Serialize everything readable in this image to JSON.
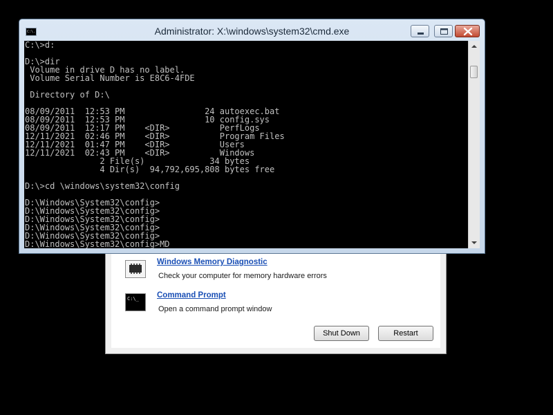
{
  "cmd_window": {
    "title": "Administrator: X:\\windows\\system32\\cmd.exe",
    "icon_label": "C:\\.",
    "console_lines": [
      "C:\\>d:",
      "",
      "D:\\>dir",
      " Volume in drive D has no label.",
      " Volume Serial Number is E8C6-4FDE",
      "",
      " Directory of D:\\",
      "",
      "08/09/2011  12:53 PM                24 autoexec.bat",
      "08/09/2011  12:53 PM                10 config.sys",
      "08/09/2011  12:17 PM    <DIR>          PerfLogs",
      "12/11/2021  02:46 PM    <DIR>          Program Files",
      "12/11/2021  01:47 PM    <DIR>          Users",
      "12/11/2021  02:43 PM    <DIR>          Windows",
      "               2 File(s)             34 bytes",
      "               4 Dir(s)  94,792,695,808 bytes free",
      "",
      "D:\\>cd \\windows\\system32\\config",
      "",
      "D:\\Windows\\System32\\config>",
      "D:\\Windows\\System32\\config>",
      "D:\\Windows\\System32\\config>",
      "D:\\Windows\\System32\\config>",
      "D:\\Windows\\System32\\config>",
      "D:\\Windows\\System32\\config>MD"
    ]
  },
  "recovery": {
    "options": [
      {
        "title": "Windows Memory Diagnostic",
        "description": "Check your computer for memory hardware errors",
        "icon": "memory-chip-icon"
      },
      {
        "title": "Command Prompt",
        "description": "Open a command prompt window",
        "icon": "command-prompt-icon",
        "icon_label": "C:\\_"
      }
    ],
    "buttons": {
      "shutdown": "Shut Down",
      "restart": "Restart"
    }
  },
  "colors": {
    "desktop": "#000000",
    "console_bg": "#000000",
    "console_text": "#c0c0c0",
    "link": "#1a4fb5"
  }
}
